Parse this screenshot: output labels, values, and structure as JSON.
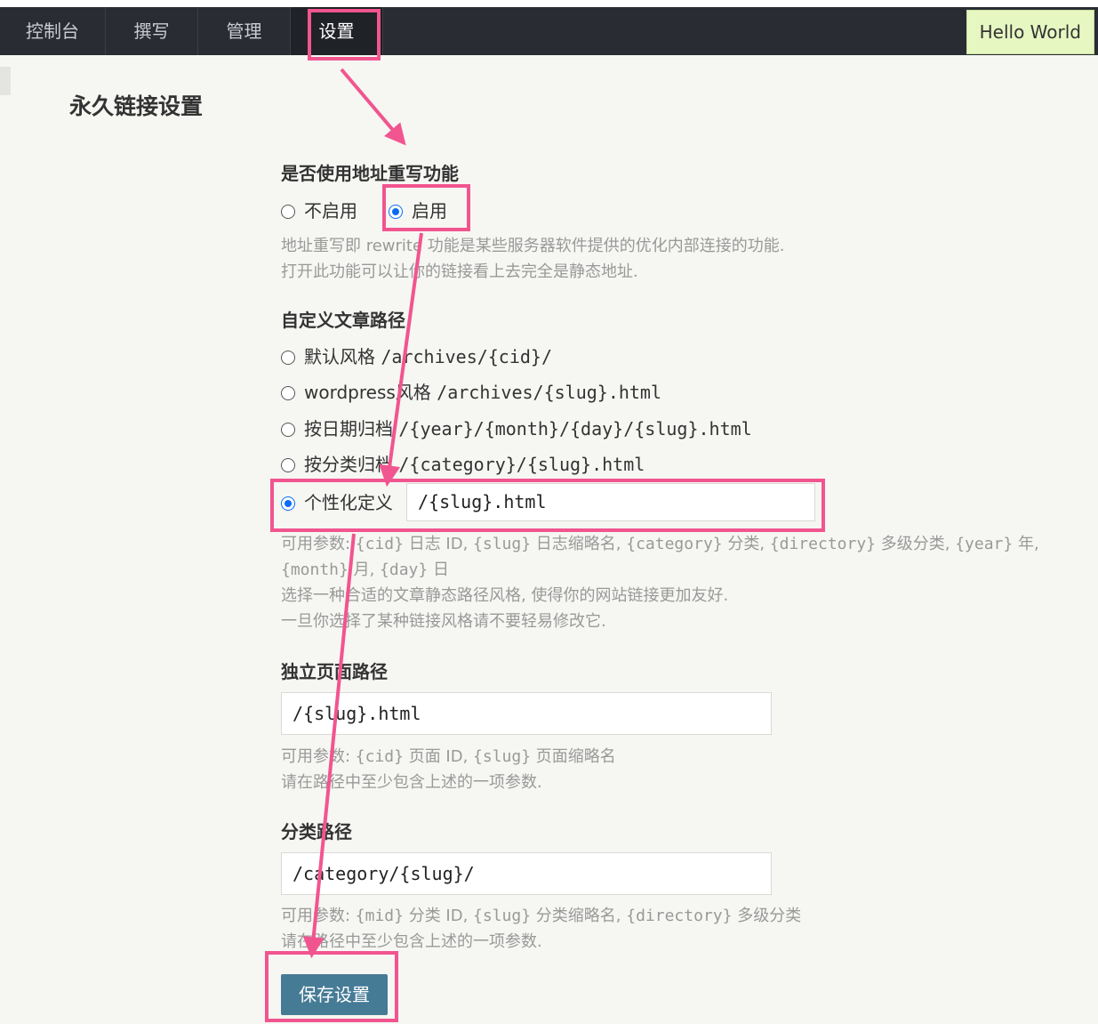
{
  "nav": {
    "items": [
      {
        "label": "控制台"
      },
      {
        "label": "撰写"
      },
      {
        "label": "管理"
      },
      {
        "label": "设置"
      }
    ],
    "user": "Hello World"
  },
  "page": {
    "title": "永久链接设置"
  },
  "rewrite": {
    "label": "是否使用地址重写功能",
    "options": [
      "不启用",
      "启用"
    ],
    "selected": "启用",
    "desc_line1": "地址重写即 rewrite 功能是某些服务器软件提供的优化内部连接的功能.",
    "desc_line2": "打开此功能可以让你的链接看上去完全是静态地址."
  },
  "post_path": {
    "label": "自定义文章路径",
    "options": [
      {
        "name": "默认风格",
        "pattern": "/archives/{cid}/"
      },
      {
        "name": "wordpress风格",
        "pattern": "/archives/{slug}.html"
      },
      {
        "name": "按日期归档",
        "pattern": "/{year}/{month}/{day}/{slug}.html"
      },
      {
        "name": "按分类归档",
        "pattern": "/{category}/{slug}.html"
      },
      {
        "name": "个性化定义",
        "pattern": ""
      }
    ],
    "selected": "个性化定义",
    "custom_value": "/{slug}.html",
    "params": {
      "p1": "可用参数: ",
      "cid": "{cid}",
      "p2": " 日志 ID, ",
      "slug": "{slug}",
      "p3": " 日志缩略名, ",
      "category": "{category}",
      "p4": " 分类, ",
      "directory": "{directory}",
      "p5": " 多级分类, ",
      "year": "{year}",
      "p6": " 年,",
      "month": "{month}",
      "p7": " 月, ",
      "day": "{day}",
      "p8": " 日"
    },
    "desc_line3": "选择一种合适的文章静态路径风格, 使得你的网站链接更加友好.",
    "desc_line4": "一旦你选择了某种链接风格请不要轻易修改它."
  },
  "page_path": {
    "label": "独立页面路径",
    "value": "/{slug}.html",
    "params": {
      "p1": "可用参数: ",
      "cid": "{cid}",
      "p2": " 页面 ID, ",
      "slug": "{slug}",
      "p3": " 页面缩略名"
    },
    "desc": "请在路径中至少包含上述的一项参数."
  },
  "category_path": {
    "label": "分类路径",
    "value": "/category/{slug}/",
    "params": {
      "p1": "可用参数: ",
      "mid": "{mid}",
      "p2": " 分类 ID, ",
      "slug": "{slug}",
      "p3": " 分类缩略名, ",
      "directory": "{directory}",
      "p4": " 多级分类"
    },
    "desc": "请在路径中至少包含上述的一项参数."
  },
  "save_label": "保存设置",
  "colors": {
    "highlight": "#f1558f",
    "navbar": "#292d33",
    "button": "#467b96",
    "radio": "#0a6cf5"
  }
}
